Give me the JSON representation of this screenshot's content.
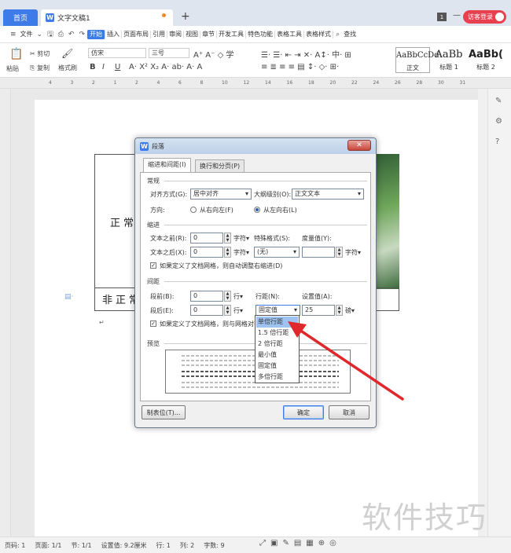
{
  "tabs": {
    "home": "首页",
    "doc": "文字文稿1",
    "page_count": "1",
    "guest": "访客登录"
  },
  "menu": {
    "file": "文件",
    "items": [
      "开始",
      "插入",
      "页面布局",
      "引用",
      "审阅",
      "视图",
      "章节",
      "开发工具",
      "特色功能",
      "表格工具",
      "表格样式"
    ],
    "search": "查找"
  },
  "ribbon": {
    "cut": "剪切",
    "paste": "粘贴",
    "copy": "复制",
    "format_painter": "格式刷",
    "font": "仿宋",
    "size": "三号",
    "bold": "B",
    "italic": "I",
    "underline": "U",
    "styles": [
      {
        "sample": "AaBbCcDd",
        "name": "正文"
      },
      {
        "sample": "AaBb",
        "name": "标题 1"
      },
      {
        "sample": "AaBb(",
        "name": "标题 2"
      }
    ]
  },
  "ruler": {
    "ticks": [
      "4",
      "3",
      "2",
      "1",
      "2",
      "4",
      "6",
      "8",
      "10",
      "12",
      "14",
      "16",
      "18",
      "20",
      "22",
      "24",
      "26",
      "28",
      "30",
      "31"
    ]
  },
  "document": {
    "cell1": "正常",
    "cell2": "非正常"
  },
  "watermark": "软件技巧",
  "status": {
    "page": "页码: 1",
    "pages": "页面: 1/1",
    "section": "节: 1/1",
    "setting": "设置值: 9.2厘米",
    "row": "行: 1",
    "col": "列: 2",
    "words": "字数: 9"
  },
  "dialog": {
    "title": "段落",
    "tabs": [
      "缩进和间距(I)",
      "换行和分页(P)"
    ],
    "general": {
      "heading": "常规",
      "align_label": "对齐方式(G):",
      "align_value": "居中对齐",
      "outline_label": "大纲级别(O):",
      "outline_value": "正文文本",
      "direction_label": "方向:",
      "rtl": "从右向左(F)",
      "ltr": "从左向右(L)"
    },
    "indent": {
      "heading": "缩进",
      "before_label": "文本之前(R):",
      "before_value": "0",
      "after_label": "文本之后(X):",
      "after_value": "0",
      "unit": "字符▾",
      "special_label": "特殊格式(S):",
      "special_value": "(无)",
      "measure_label": "度量值(Y):",
      "measure_unit": "字符▾",
      "auto_adjust": "如果定义了文档网格，则自动调整右缩进(D)"
    },
    "spacing": {
      "heading": "间距",
      "before_label": "段前(B):",
      "before_value": "0",
      "after_label": "段后(E):",
      "after_value": "0",
      "unit": "行▾",
      "line_label": "行距(N):",
      "line_value": "固定值",
      "setting_label": "设置值(A):",
      "setting_value": "25",
      "setting_unit": "磅▾",
      "grid_align": "如果定义了文档网格，则与网格对齐"
    },
    "preview": {
      "heading": "预览"
    },
    "buttons": {
      "tabs": "制表位(T)...",
      "ok": "确定",
      "cancel": "取消"
    },
    "line_options": [
      "单倍行距",
      "1.5 倍行距",
      "2 倍行距",
      "最小值",
      "固定值",
      "多倍行距"
    ]
  },
  "colors": {
    "accent": "#3c7be8",
    "arrow": "#e0282c",
    "highlight": "#9fc3f0"
  }
}
